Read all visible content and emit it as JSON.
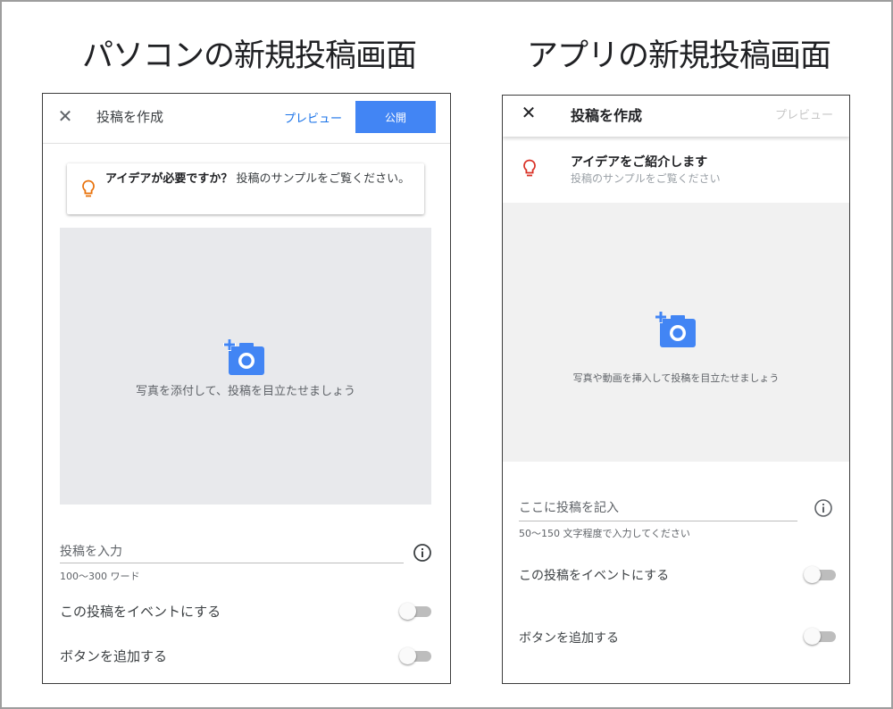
{
  "headings": {
    "pc": "パソコンの新規投稿画面",
    "app": "アプリの新規投稿画面"
  },
  "pc": {
    "close_glyph": "✕",
    "title": "投稿を作成",
    "preview": "プレビュー",
    "publish": "公開",
    "ideas_bold": "アイデアが必要ですか？",
    "ideas_text": " 投稿のサンプルをご覧ください。",
    "photo_caption": "写真を添付して、投稿を目立たせましょう",
    "post_placeholder": "投稿を入力",
    "post_hint": "100〜300 ワード",
    "event_label": "この投稿をイベントにする",
    "button_label": "ボタンを追加する",
    "event_toggle_on": false,
    "button_toggle_on": false
  },
  "app": {
    "close_glyph": "✕",
    "title": "投稿を作成",
    "preview": "プレビュー",
    "ideas_title": "アイデアをご紹介します",
    "ideas_sub": "投稿のサンプルをご覧ください",
    "photo_caption": "写真や動画を挿入して投稿を目立たせましょう",
    "post_placeholder": "ここに投稿を記入",
    "post_hint": "50〜150 文字程度で入力してください",
    "event_label": "この投稿をイベントにする",
    "button_label": "ボタンを追加する",
    "event_toggle_on": false,
    "button_toggle_on": false
  },
  "colors": {
    "accent_blue": "#4285f4",
    "link_blue": "#1a73e8",
    "bulb_orange": "#e8710a",
    "bulb_red": "#d93025",
    "photo_bg_pc": "#e8e9ec",
    "photo_bg_app": "#f1f1f1"
  },
  "icons": [
    "close-icon",
    "lightbulb-icon",
    "add-photo-icon",
    "info-icon"
  ]
}
